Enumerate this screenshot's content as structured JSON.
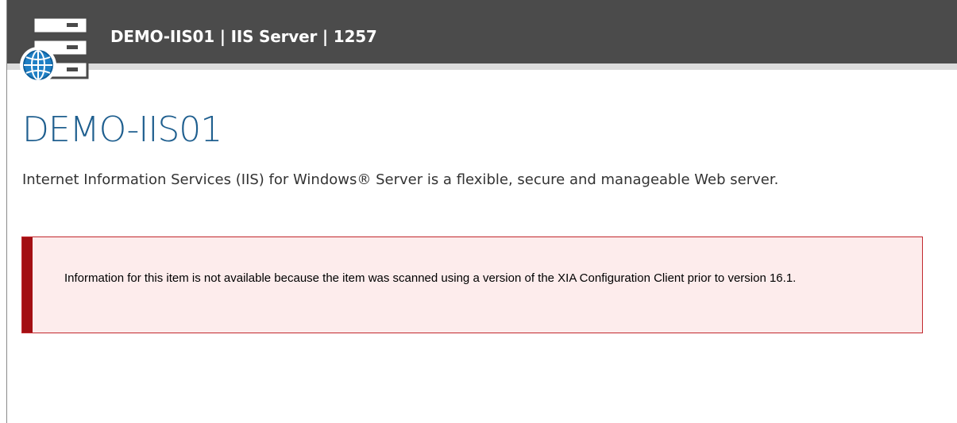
{
  "header": {
    "title": "DEMO-IIS01 | IIS Server | 1257",
    "icon": "iis-server-globe-icon",
    "background_color": "#4b4b4b"
  },
  "main": {
    "title": "DEMO-IIS01",
    "description": "Internet Information Services (IIS) for Windows® Server is a flexible, secure and manageable Web server."
  },
  "alert": {
    "message": "Information for this item is not available because the item was scanned using a version of the XIA Configuration Client prior to version 16.1.",
    "accent_color": "#a30f13",
    "background_color": "#fdecec"
  }
}
